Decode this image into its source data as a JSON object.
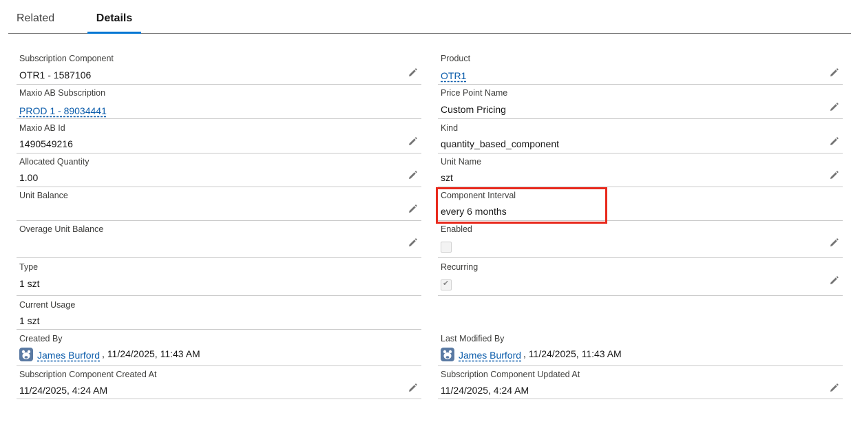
{
  "tabs": [
    {
      "label": "Related"
    },
    {
      "label": "Details"
    }
  ],
  "fields": {
    "subscription_component": {
      "label": "Subscription Component",
      "value": "OTR1 - 1587106"
    },
    "product": {
      "label": "Product",
      "value": "OTR1"
    },
    "maxio_ab_subscription": {
      "label": "Maxio AB Subscription",
      "value": "PROD 1 - 89034441"
    },
    "price_point_name": {
      "label": "Price Point Name",
      "value": "Custom Pricing"
    },
    "maxio_ab_id": {
      "label": "Maxio AB Id",
      "value": "1490549216"
    },
    "kind": {
      "label": "Kind",
      "value": "quantity_based_component"
    },
    "allocated_quantity": {
      "label": "Allocated Quantity",
      "value": "1.00"
    },
    "unit_name": {
      "label": "Unit Name",
      "value": "szt"
    },
    "unit_balance": {
      "label": "Unit Balance",
      "value": ""
    },
    "component_interval": {
      "label": "Component Interval",
      "value": "every 6 months"
    },
    "overage_unit_balance": {
      "label": "Overage Unit Balance",
      "value": ""
    },
    "enabled": {
      "label": "Enabled",
      "checked": false
    },
    "type": {
      "label": "Type",
      "value": "1 szt"
    },
    "recurring": {
      "label": "Recurring",
      "checked": true
    },
    "current_usage": {
      "label": "Current Usage",
      "value": "1 szt"
    },
    "created_by": {
      "label": "Created By",
      "user": "James Burford",
      "date": ", 11/24/2025, 11:43 AM"
    },
    "last_modified_by": {
      "label": "Last Modified By",
      "user": "James Burford",
      "date": ", 11/24/2025, 11:43 AM"
    },
    "created_at": {
      "label": "Subscription Component Created At",
      "value": "11/24/2025, 4:24 AM"
    },
    "updated_at": {
      "label": "Subscription Component Updated At",
      "value": "11/24/2025, 4:24 AM"
    }
  },
  "icons": {
    "edit": "pencil-icon",
    "avatar": "user-avatar-icon"
  },
  "colors": {
    "link": "#0b5cab",
    "tab_active": "#0176d3",
    "highlight": "#e8291c"
  }
}
